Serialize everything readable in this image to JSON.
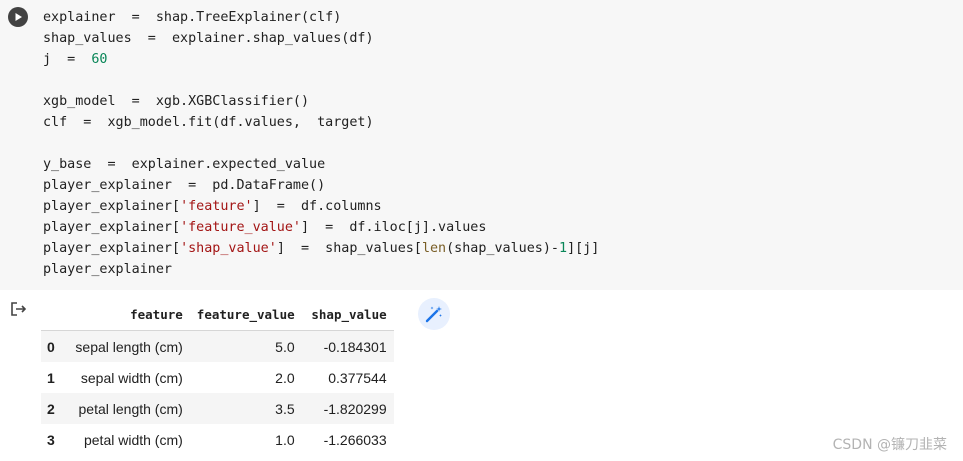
{
  "code_lines": [
    [
      {
        "t": "explainer  =  shap.TreeExplainer(clf)",
        "c": ""
      }
    ],
    [
      {
        "t": "shap_values  =  explainer.shap_values(df)",
        "c": ""
      }
    ],
    [
      {
        "t": "j  =  ",
        "c": ""
      },
      {
        "t": "60",
        "c": "num"
      }
    ],
    [
      {
        "t": "",
        "c": ""
      }
    ],
    [
      {
        "t": "xgb_model  =  xgb.XGBClassifier()",
        "c": ""
      }
    ],
    [
      {
        "t": "clf  =  xgb_model.fit(df.values,  target)",
        "c": ""
      }
    ],
    [
      {
        "t": "",
        "c": ""
      }
    ],
    [
      {
        "t": "y_base  =  explainer.expected_value",
        "c": ""
      }
    ],
    [
      {
        "t": "player_explainer  =  pd.DataFrame()",
        "c": ""
      }
    ],
    [
      {
        "t": "player_explainer[",
        "c": ""
      },
      {
        "t": "'feature'",
        "c": "str"
      },
      {
        "t": "]  =  df.columns",
        "c": ""
      }
    ],
    [
      {
        "t": "player_explainer[",
        "c": ""
      },
      {
        "t": "'feature_value'",
        "c": "str"
      },
      {
        "t": "]  =  df.iloc[j].values",
        "c": ""
      }
    ],
    [
      {
        "t": "player_explainer[",
        "c": ""
      },
      {
        "t": "'shap_value'",
        "c": "str"
      },
      {
        "t": "]  =  shap_values[",
        "c": ""
      },
      {
        "t": "len",
        "c": "fn"
      },
      {
        "t": "(shap_values)-",
        "c": ""
      },
      {
        "t": "1",
        "c": "num"
      },
      {
        "t": "][j]",
        "c": ""
      }
    ],
    [
      {
        "t": "player_explainer",
        "c": ""
      }
    ]
  ],
  "table": {
    "headers": [
      "",
      "feature",
      "feature_value",
      "shap_value"
    ],
    "rows": [
      {
        "index": "0",
        "feature": "sepal length (cm)",
        "feature_value": "5.0",
        "shap_value": "-0.184301"
      },
      {
        "index": "1",
        "feature": "sepal width (cm)",
        "feature_value": "2.0",
        "shap_value": "0.377544"
      },
      {
        "index": "2",
        "feature": "petal length (cm)",
        "feature_value": "3.5",
        "shap_value": "-1.820299"
      },
      {
        "index": "3",
        "feature": "petal width (cm)",
        "feature_value": "1.0",
        "shap_value": "-1.266033"
      }
    ]
  },
  "icons": {
    "run": "play-icon",
    "output": "output-arrow-icon",
    "magic": "magic-wand-icon"
  },
  "colors": {
    "number": "#098658",
    "string": "#a31515",
    "function": "#795e26",
    "cell_bg": "#f7f7f7"
  },
  "watermark": "CSDN @镰刀韭菜"
}
